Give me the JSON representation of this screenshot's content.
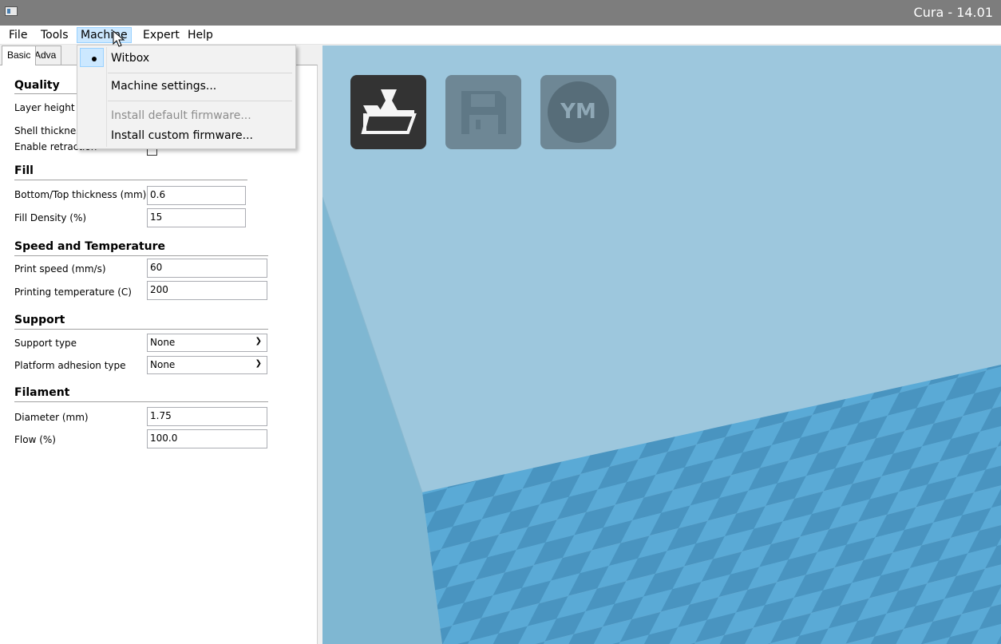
{
  "window": {
    "title": "Cura - 14.01"
  },
  "menubar": {
    "items": [
      "File",
      "Tools",
      "Machine",
      "Expert",
      "Help"
    ],
    "active": "Machine"
  },
  "tabs": [
    "Basic",
    "Adva"
  ],
  "machine_menu": {
    "items": [
      {
        "label": "Witbox",
        "checked": true,
        "enabled": true
      },
      {
        "label": "Machine settings...",
        "enabled": true
      },
      {
        "label": "Install default firmware...",
        "enabled": false
      },
      {
        "label": "Install custom firmware...",
        "enabled": true
      }
    ]
  },
  "sections": {
    "quality": {
      "title": "Quality",
      "layer_height_label": "Layer height",
      "shell_thickness_label": "Shell thicknes",
      "enable_retraction_label": "Enable retraction"
    },
    "fill": {
      "title": "Fill",
      "bottom_top_label": "Bottom/Top thickness (mm)",
      "bottom_top_value": "0.6",
      "fill_density_label": "Fill Density (%)",
      "fill_density_value": "15"
    },
    "speed": {
      "title": "Speed and Temperature",
      "print_speed_label": "Print speed (mm/s)",
      "print_speed_value": "60",
      "print_temp_label": "Printing temperature (C)",
      "print_temp_value": "200"
    },
    "support": {
      "title": "Support",
      "support_type_label": "Support type",
      "support_type_value": "None",
      "adhesion_label": "Platform adhesion type",
      "adhesion_value": "None"
    },
    "filament": {
      "title": "Filament",
      "diameter_label": "Diameter (mm)",
      "diameter_value": "1.75",
      "flow_label": "Flow (%)",
      "flow_value": "100.0"
    }
  },
  "toolbar": {
    "ym_label": "YM"
  },
  "colors": {
    "accent": "#cce8ff",
    "viewport_bg": "#9dc7dd",
    "grid_a": "#5aaad6",
    "grid_b": "#4994c0"
  }
}
